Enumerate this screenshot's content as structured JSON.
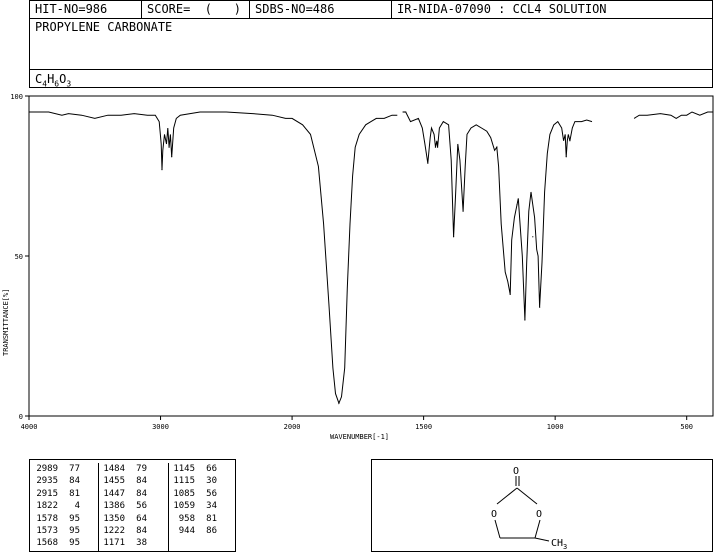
{
  "header": {
    "hit_no": "HIT-NO=986",
    "score": "SCORE=  (   )",
    "sdbs_no": "SDBS-NO=486",
    "ir_info": "IR-NIDA-07090 : CCL4 SOLUTION",
    "compound_name": "PROPYLENE CARBONATE",
    "formula": {
      "c": "C",
      "c_n": "4",
      "h": "H",
      "h_n": "6",
      "o": "O",
      "o_n": "3"
    }
  },
  "chart_data": {
    "type": "line",
    "xlabel": "WAVENUMBER[-1]",
    "ylabel": "TRANSMITTANCE[%]",
    "xlim": [
      4000,
      400
    ],
    "ylim": [
      0,
      100
    ],
    "xticks": [
      "4000",
      "3000",
      "2000",
      "1500",
      "1000",
      "500"
    ],
    "yticks": [
      "100",
      "50",
      "0"
    ],
    "grid": false,
    "segments": [
      [
        [
          4000,
          95
        ],
        [
          3850,
          95
        ],
        [
          3750,
          94
        ],
        [
          3700,
          94.5
        ],
        [
          3600,
          94
        ],
        [
          3500,
          93
        ],
        [
          3400,
          94
        ],
        [
          3300,
          94
        ],
        [
          3200,
          94.5
        ],
        [
          3100,
          94
        ],
        [
          3040,
          94
        ],
        [
          3010,
          92
        ],
        [
          2995,
          85
        ],
        [
          2989,
          77
        ],
        [
          2983,
          83
        ],
        [
          2970,
          88
        ],
        [
          2955,
          85
        ],
        [
          2945,
          90
        ],
        [
          2935,
          84
        ],
        [
          2925,
          88
        ],
        [
          2915,
          81
        ],
        [
          2900,
          90
        ],
        [
          2880,
          93
        ],
        [
          2850,
          94
        ],
        [
          2700,
          95
        ],
        [
          2500,
          95
        ],
        [
          2300,
          94.5
        ],
        [
          2150,
          94
        ],
        [
          2050,
          93
        ],
        [
          2000,
          93
        ],
        [
          1960,
          91
        ],
        [
          1930,
          88
        ],
        [
          1900,
          78
        ],
        [
          1880,
          60
        ],
        [
          1860,
          35
        ],
        [
          1845,
          15
        ],
        [
          1835,
          7
        ],
        [
          1822,
          4
        ],
        [
          1812,
          6
        ],
        [
          1800,
          15
        ],
        [
          1790,
          40
        ],
        [
          1780,
          60
        ],
        [
          1770,
          75
        ],
        [
          1760,
          84
        ],
        [
          1745,
          88
        ],
        [
          1720,
          91
        ],
        [
          1700,
          92
        ],
        [
          1680,
          93
        ],
        [
          1650,
          93
        ],
        [
          1620,
          94
        ],
        [
          1600,
          94
        ]
      ],
      [
        [
          1578,
          95
        ],
        [
          1573,
          95
        ],
        [
          1568,
          95
        ],
        [
          1550,
          92
        ],
        [
          1520,
          93
        ],
        [
          1505,
          90
        ],
        [
          1495,
          85
        ],
        [
          1484,
          79
        ],
        [
          1475,
          87
        ],
        [
          1470,
          90
        ],
        [
          1460,
          88
        ],
        [
          1455,
          84
        ],
        [
          1450,
          86
        ],
        [
          1447,
          84
        ],
        [
          1440,
          90
        ],
        [
          1425,
          92
        ],
        [
          1405,
          91
        ],
        [
          1395,
          80
        ],
        [
          1386,
          56
        ],
        [
          1378,
          70
        ],
        [
          1370,
          85
        ],
        [
          1362,
          80
        ],
        [
          1350,
          64
        ],
        [
          1342,
          78
        ],
        [
          1335,
          88
        ],
        [
          1320,
          90
        ],
        [
          1300,
          91
        ],
        [
          1280,
          90
        ],
        [
          1260,
          89
        ],
        [
          1245,
          87
        ],
        [
          1230,
          83
        ],
        [
          1222,
          84
        ],
        [
          1215,
          78
        ],
        [
          1205,
          60
        ],
        [
          1190,
          45
        ],
        [
          1180,
          42
        ],
        [
          1171,
          38
        ],
        [
          1165,
          55
        ],
        [
          1155,
          62
        ],
        [
          1145,
          66
        ],
        [
          1140,
          68
        ],
        [
          1135,
          62
        ],
        [
          1125,
          50
        ],
        [
          1115,
          30
        ],
        [
          1108,
          48
        ],
        [
          1100,
          64
        ],
        [
          1092,
          70
        ],
        [
          1085,
          66
        ],
        [
          1078,
          62
        ],
        [
          1070,
          52
        ],
        [
          1065,
          50
        ],
        [
          1059,
          34
        ],
        [
          1050,
          48
        ],
        [
          1040,
          70
        ],
        [
          1030,
          82
        ],
        [
          1020,
          88
        ],
        [
          1005,
          91
        ],
        [
          990,
          92
        ],
        [
          975,
          90
        ],
        [
          968,
          86
        ],
        [
          962,
          88
        ],
        [
          958,
          81
        ],
        [
          954,
          86
        ],
        [
          950,
          88
        ],
        [
          944,
          86
        ],
        [
          935,
          90
        ],
        [
          925,
          92
        ],
        [
          900,
          92
        ],
        [
          880,
          92.5
        ],
        [
          860,
          92
        ]
      ],
      [
        [
          700,
          93
        ],
        [
          680,
          94
        ],
        [
          650,
          94
        ],
        [
          600,
          94.5
        ],
        [
          560,
          94
        ],
        [
          540,
          93
        ],
        [
          520,
          94
        ],
        [
          500,
          94
        ],
        [
          480,
          95
        ],
        [
          450,
          94
        ],
        [
          420,
          95
        ],
        [
          400,
          95
        ]
      ]
    ],
    "peaks": [
      [
        2989,
        77
      ],
      [
        2935,
        84
      ],
      [
        2915,
        81
      ],
      [
        1822,
        4
      ],
      [
        1578,
        95
      ],
      [
        1573,
        95
      ],
      [
        1568,
        95
      ],
      [
        1484,
        79
      ],
      [
        1455,
        84
      ],
      [
        1447,
        84
      ],
      [
        1386,
        56
      ],
      [
        1350,
        64
      ],
      [
        1222,
        84
      ],
      [
        1171,
        38
      ],
      [
        1145,
        66
      ],
      [
        1115,
        30
      ],
      [
        1085,
        56
      ],
      [
        1059,
        34
      ],
      [
        958,
        81
      ],
      [
        944,
        86
      ]
    ]
  },
  "structure": {
    "o_carbonyl": "O",
    "o_left": "O",
    "o_right": "O",
    "ch3": "CH",
    "ch3_sub": "3"
  }
}
